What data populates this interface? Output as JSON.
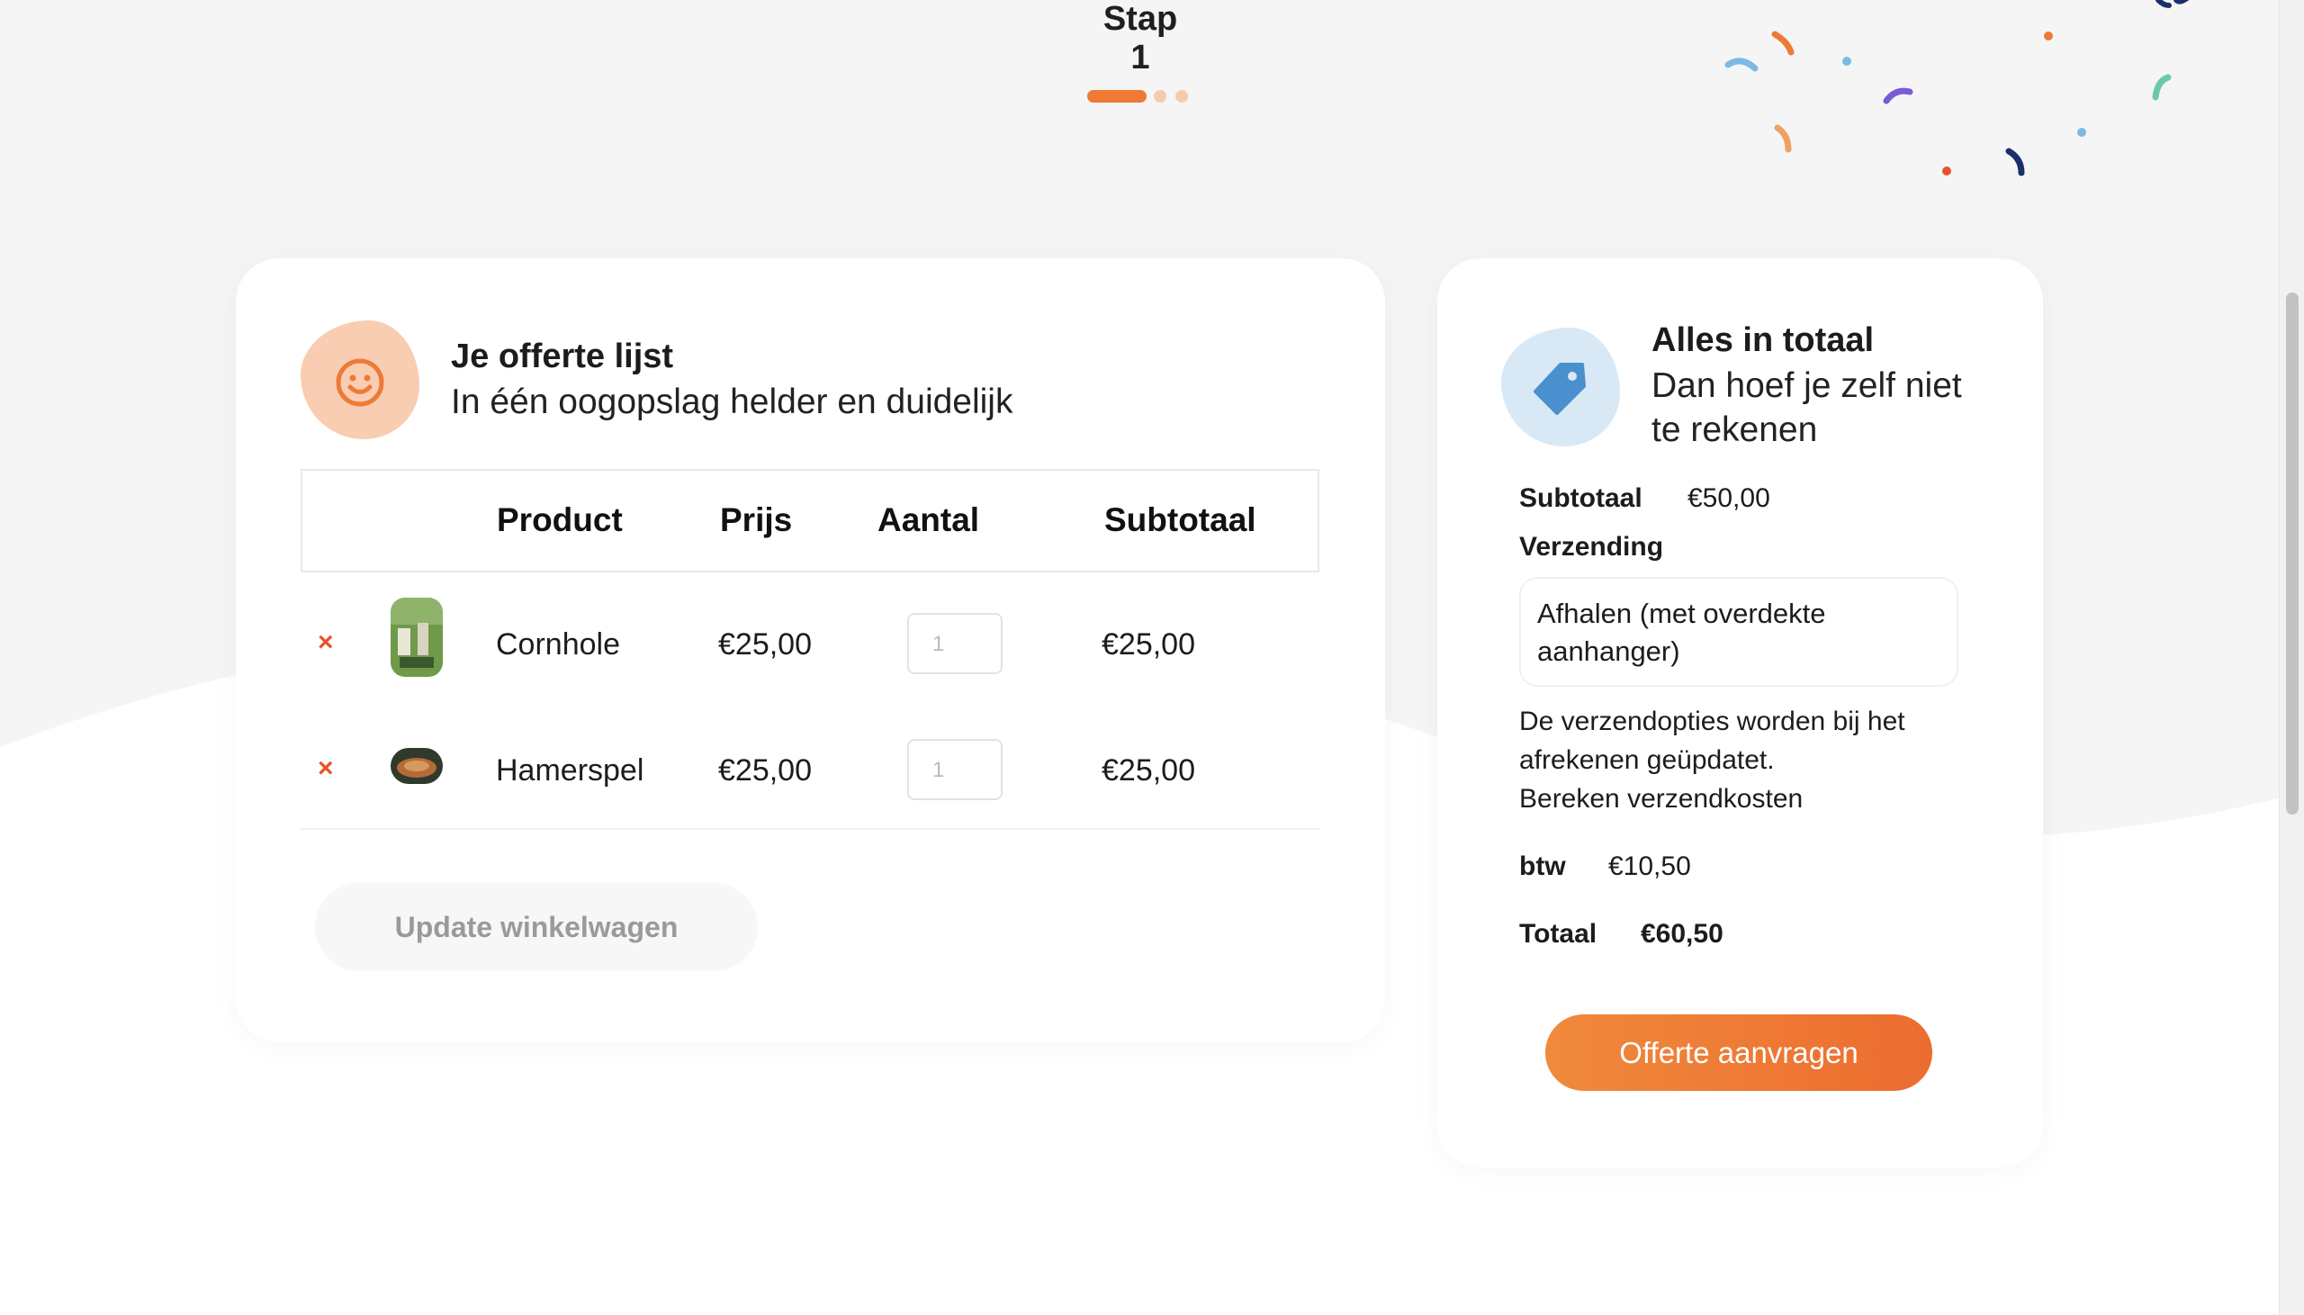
{
  "stepper": {
    "title": "Stap 1",
    "current_step": 1,
    "total_steps": 3
  },
  "quote": {
    "title": "Je offerte lijst",
    "subtitle": "In één oogopslag helder en duidelijk",
    "columns": [
      "Product",
      "Prijs",
      "Aantal",
      "Subtotaal"
    ],
    "rows": [
      {
        "remove": "×",
        "product": "Cornhole",
        "price": "€25,00",
        "qty": "1",
        "subtotal": "€25,00"
      },
      {
        "remove": "×",
        "product": "Hamerspel",
        "price": "€25,00",
        "qty": "1",
        "subtotal": "€25,00"
      }
    ],
    "update_button": "Update winkelwagen"
  },
  "totals": {
    "title": "Alles in totaal",
    "subtitle_line1": "Dan hoef je zelf niet",
    "subtitle_line2": "te rekenen",
    "subtotal_label": "Subtotaal",
    "subtotal_value": "€50,00",
    "shipping_label": "Verzending",
    "shipping_option_line1": "Afhalen (met overdekte",
    "shipping_option_line2": "aanhanger)",
    "shipping_note_line1": "De verzendopties worden bij het",
    "shipping_note_line2": "afrekenen geüpdatet.",
    "shipping_calc_link": "Bereken verzendkosten",
    "vat_label": "btw",
    "vat_value": "€10,50",
    "total_label": "Totaal",
    "total_value": "€60,50",
    "cta": "Offerte aanvragen"
  },
  "colors": {
    "accent": "#ee7a36",
    "remove": "#e6542b",
    "background": "#f5f5f5"
  },
  "icons": {
    "quote": "smiley-icon",
    "totals": "price-tag-icon",
    "remove": "close-icon"
  }
}
